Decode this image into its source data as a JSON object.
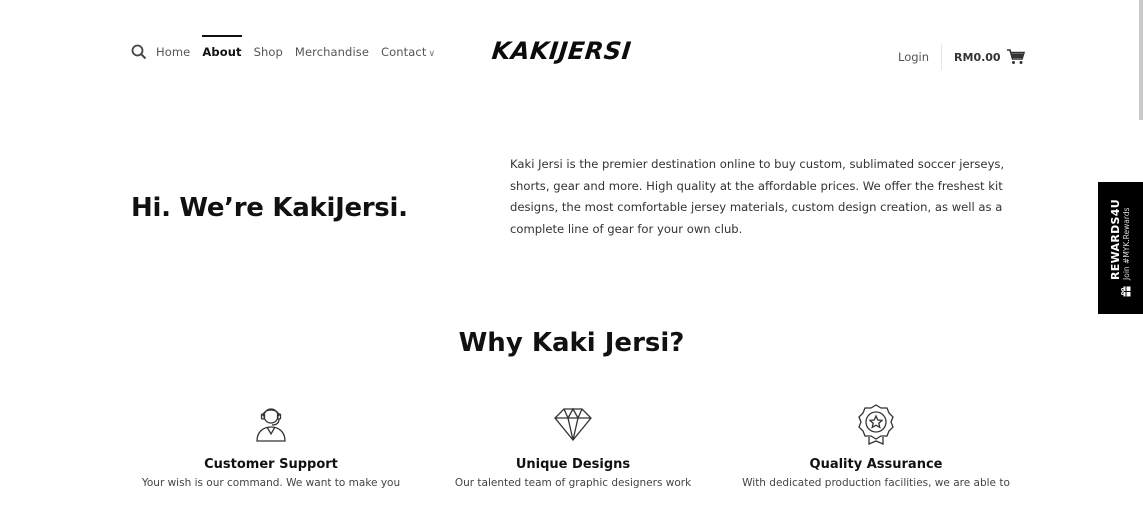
{
  "nav": {
    "items": [
      {
        "label": "Home"
      },
      {
        "label": "About"
      },
      {
        "label": "Shop"
      },
      {
        "label": "Merchandise"
      },
      {
        "label": "Contact"
      }
    ]
  },
  "logo": {
    "text": "KAKIJERSI"
  },
  "account": {
    "login_label": "Login",
    "cart_total": "RM0.00"
  },
  "intro": {
    "title": "Hi. We’re KakiJersi.",
    "text": "Kaki Jersi is the premier destination online to buy custom, sublimated soccer jerseys, shorts, gear and more. High quality at the affordable prices. We offer the freshest kit designs, the most comfortable jersey materials, custom design creation, as well as a complete line of gear for your own club."
  },
  "rewards": {
    "title": "REWARDS4U",
    "subtitle": "Join #MYK.Rewards"
  },
  "why": {
    "title": "Why Kaki Jersi?"
  },
  "features": [
    {
      "title": "Customer Support",
      "text": "Your wish is our command. We want to make you",
      "icon": "headset-support-icon"
    },
    {
      "title": "Unique Designs",
      "text": "Our talented team of graphic designers work",
      "icon": "diamond-icon"
    },
    {
      "title": "Quality Assurance",
      "text": "With dedicated production facilities, we are able to",
      "icon": "award-badge-icon"
    }
  ]
}
